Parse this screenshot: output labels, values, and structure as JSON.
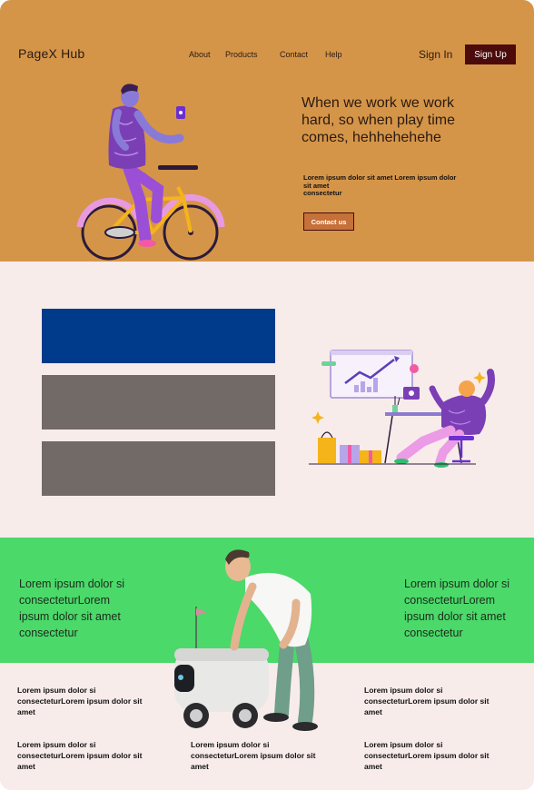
{
  "header": {
    "logo": "PageX Hub",
    "nav": [
      "About",
      "Products",
      "Contact",
      "Help"
    ],
    "sign_in": "Sign In",
    "sign_up": "Sign Up"
  },
  "hero": {
    "title": "When we work we work hard, so when play time comes, hehhehehehe",
    "subtitle": "Lorem ipsum dolor sit amet Lorem ipsum dolor sit amet\n consectetur",
    "cta": "Contact us"
  },
  "green": {
    "left_text": "Lorem ipsum dolor si consecteturLorem ipsum dolor sit amet consectetur",
    "right_text": "Lorem ipsum dolor si consecteturLorem ipsum dolor sit amet consectetur"
  },
  "bottom": {
    "cells": [
      "Lorem ipsum dolor si consecteturLorem ipsum dolor sit amet",
      "Lorem ipsum dolor si consecteturLorem ipsum dolor sit amet",
      "Lorem ipsum dolor si consecteturLorem ipsum dolor sit amet",
      "Lorem ipsum dolor si consecteturLorem ipsum dolor sit amet",
      "Lorem ipsum dolor si consecteturLorem ipsum dolor sit amet"
    ]
  },
  "colors": {
    "hero_bg": "#d59549",
    "accent_dark": "#4b0b0b",
    "mid_bg": "#f8eceb",
    "blue_bar": "#003a8a",
    "gray_bar": "#726a67",
    "green_bg": "#4bd96a"
  }
}
